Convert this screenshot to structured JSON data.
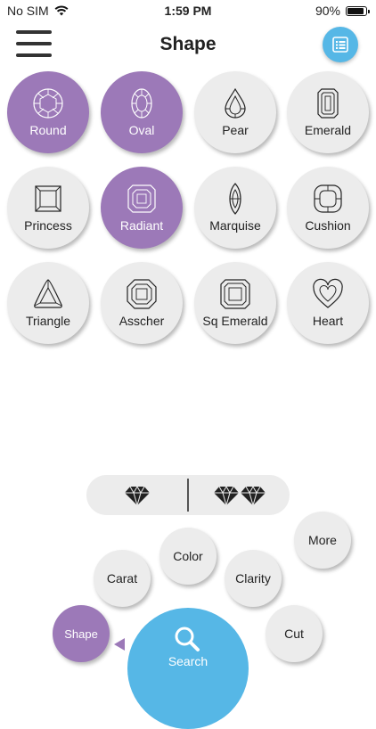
{
  "status": {
    "carrier": "No SIM",
    "time": "1:59 PM",
    "battery": "90%"
  },
  "header": {
    "title": "Shape"
  },
  "shapes": [
    {
      "label": "Round",
      "icon": "round-diamond-icon",
      "selected": true
    },
    {
      "label": "Oval",
      "icon": "oval-diamond-icon",
      "selected": true
    },
    {
      "label": "Pear",
      "icon": "pear-diamond-icon",
      "selected": false
    },
    {
      "label": "Emerald",
      "icon": "emerald-diamond-icon",
      "selected": false
    },
    {
      "label": "Princess",
      "icon": "princess-diamond-icon",
      "selected": false
    },
    {
      "label": "Radiant",
      "icon": "radiant-diamond-icon",
      "selected": true
    },
    {
      "label": "Marquise",
      "icon": "marquise-diamond-icon",
      "selected": false
    },
    {
      "label": "Cushion",
      "icon": "cushion-diamond-icon",
      "selected": false
    },
    {
      "label": "Triangle",
      "icon": "triangle-diamond-icon",
      "selected": false
    },
    {
      "label": "Asscher",
      "icon": "asscher-diamond-icon",
      "selected": false
    },
    {
      "label": "Sq Emerald",
      "icon": "sq-emerald-diamond-icon",
      "selected": false
    },
    {
      "label": "Heart",
      "icon": "heart-diamond-icon",
      "selected": false
    }
  ],
  "menu": {
    "more": "More",
    "color": "Color",
    "carat": "Carat",
    "clarity": "Clarity",
    "shape": "Shape",
    "cut": "Cut",
    "search": "Search"
  },
  "colors": {
    "selected": "#9c79b8",
    "accent": "#56b7e6",
    "bubble": "#ececec"
  }
}
